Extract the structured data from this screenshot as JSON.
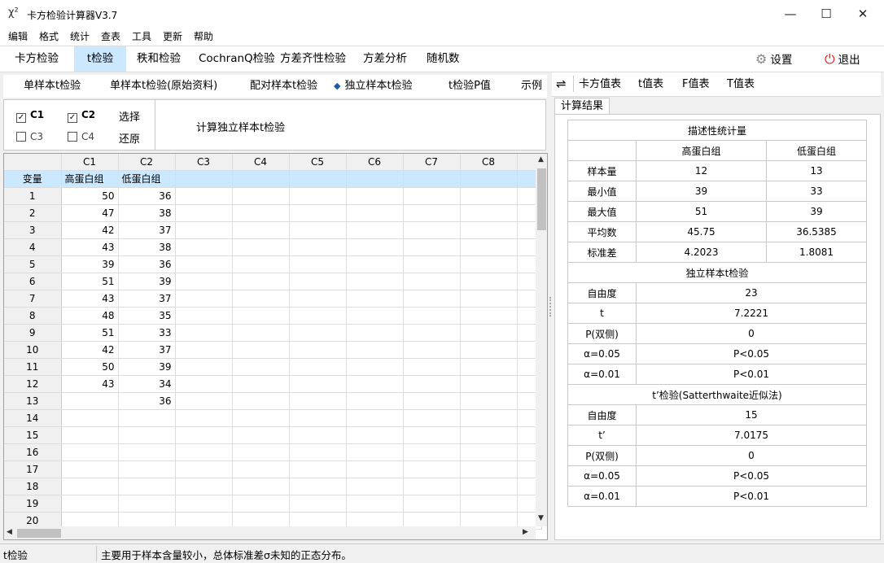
{
  "window": {
    "title": "卡方检验计算器V3.7",
    "app_icon": "χ²",
    "minimize": "—",
    "maximize": "☐",
    "close": "✕"
  },
  "menu": [
    "编辑",
    "格式",
    "统计",
    "查表",
    "工具",
    "更新",
    "帮助"
  ],
  "main_tabs": [
    "卡方检验",
    "t检验",
    "秩和检验",
    "CochranQ检验",
    "方差齐性检验",
    "方差分析",
    "随机数"
  ],
  "active_main_tab": 1,
  "header_buttons": {
    "settings": "设置",
    "exit": "退出"
  },
  "sub_tabs": [
    "单样本t检验",
    "单样本t检验(原始资料)",
    "配对样本t检验",
    "独立样本t检验",
    "t检验P值",
    "示例"
  ],
  "options": {
    "c1": "C1",
    "c2": "C2",
    "c3": "C3",
    "c4": "C4",
    "select": "选择",
    "restore": "还原",
    "calculate": "计算独立样本t检验"
  },
  "grid": {
    "columns": [
      "C1",
      "C2",
      "C3",
      "C4",
      "C5",
      "C6",
      "C7",
      "C8"
    ],
    "var_label": "变量",
    "var_names": [
      "高蛋白组",
      "低蛋白组"
    ],
    "rows": [
      [
        "1",
        "50",
        "36"
      ],
      [
        "2",
        "47",
        "38"
      ],
      [
        "3",
        "42",
        "37"
      ],
      [
        "4",
        "43",
        "38"
      ],
      [
        "5",
        "39",
        "36"
      ],
      [
        "6",
        "51",
        "39"
      ],
      [
        "7",
        "43",
        "37"
      ],
      [
        "8",
        "48",
        "35"
      ],
      [
        "9",
        "51",
        "33"
      ],
      [
        "10",
        "42",
        "37"
      ],
      [
        "11",
        "50",
        "39"
      ],
      [
        "12",
        "43",
        "34"
      ],
      [
        "13",
        "",
        "36"
      ],
      [
        "14",
        "",
        ""
      ],
      [
        "15",
        "",
        ""
      ],
      [
        "16",
        "",
        ""
      ],
      [
        "17",
        "",
        ""
      ],
      [
        "18",
        "",
        ""
      ],
      [
        "19",
        "",
        ""
      ],
      [
        "20",
        "",
        ""
      ]
    ]
  },
  "right_tabs": {
    "swap": "⇌",
    "items": [
      "卡方值表",
      "t值表",
      "F值表",
      "T值表"
    ]
  },
  "result_tab": "计算结果",
  "results": {
    "desc_title": "描述性统计量",
    "groups": [
      "高蛋白组",
      "低蛋白组"
    ],
    "desc_rows": [
      [
        "样本量",
        "12",
        "13"
      ],
      [
        "最小值",
        "39",
        "33"
      ],
      [
        "最大值",
        "51",
        "39"
      ],
      [
        "平均数",
        "45.75",
        "36.5385"
      ],
      [
        "标准差",
        "4.2023",
        "1.8081"
      ]
    ],
    "t_title": "独立样本t检验",
    "t_rows": [
      [
        "自由度",
        "23"
      ],
      [
        "t",
        "7.2221"
      ],
      [
        "P(双侧)",
        "0"
      ],
      [
        "α=0.05",
        "P<0.05"
      ],
      [
        "α=0.01",
        "P<0.01"
      ]
    ],
    "tp_title": "t’检验(Satterthwaite近似法)",
    "tp_rows": [
      [
        "自由度",
        "15"
      ],
      [
        "t’",
        "7.0175"
      ],
      [
        "P(双侧)",
        "0"
      ],
      [
        "α=0.05",
        "P<0.05"
      ],
      [
        "α=0.01",
        "P<0.01"
      ]
    ]
  },
  "status": {
    "left": "t检验",
    "message": "主要用于样本含量较小，总体标准差σ未知的正态分布。"
  }
}
